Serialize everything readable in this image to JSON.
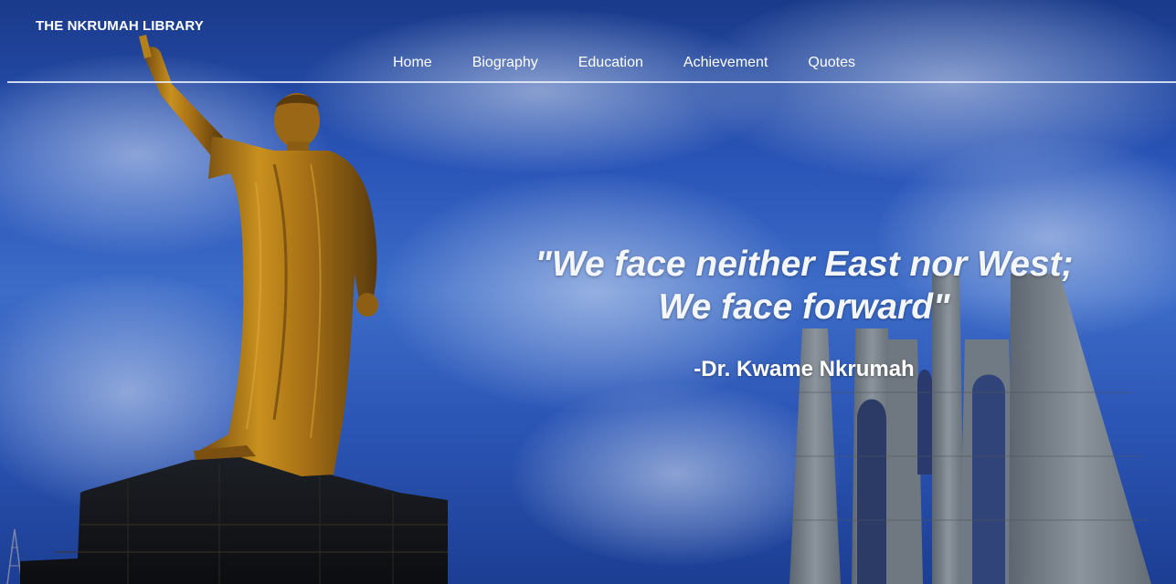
{
  "brand": {
    "title": "THE NKRUMAH LIBRARY"
  },
  "nav": {
    "items": [
      {
        "label": "Home"
      },
      {
        "label": "Biography"
      },
      {
        "label": "Education"
      },
      {
        "label": "Achievement"
      },
      {
        "label": "Quotes"
      }
    ]
  },
  "hero": {
    "quote_line_1": "\"We face neither East nor West;",
    "quote_line_2": "We face forward\"",
    "author": "-Dr. Kwame Nkrumah"
  },
  "colors": {
    "sky": "#2a55b8",
    "text": "#ffffff",
    "statue": "#b07a1e",
    "pedestal": "#121418",
    "memorial": "#7d8590"
  }
}
